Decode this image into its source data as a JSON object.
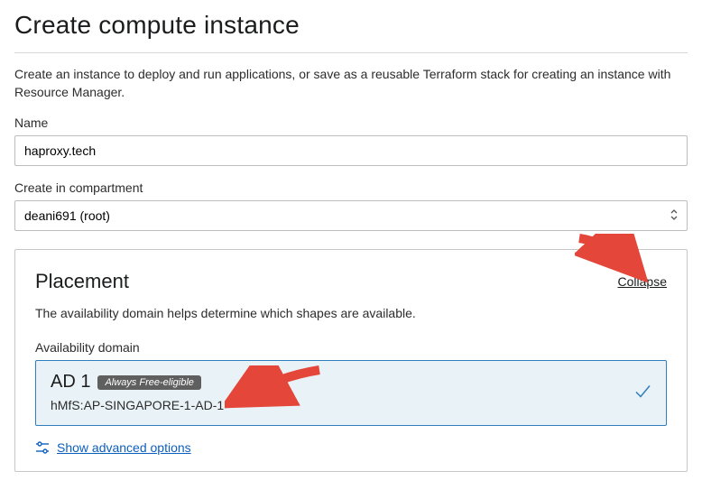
{
  "page": {
    "title": "Create compute instance",
    "intro": "Create an instance to deploy and run applications, or save as a reusable Terraform stack for creating an instance with Resource Manager."
  },
  "name_field": {
    "label": "Name",
    "value": "haproxy.tech"
  },
  "compartment": {
    "label": "Create in compartment",
    "selected": "deani691 (root)"
  },
  "placement": {
    "title": "Placement",
    "collapse_label": "Collapse",
    "description": "The availability domain helps determine which shapes are available.",
    "ad_label": "Availability domain",
    "ad": {
      "name": "AD 1",
      "badge": "Always Free-eligible",
      "full_id": "hMfS:AP-SINGAPORE-1-AD-1"
    },
    "advanced_label": "Show advanced options"
  }
}
